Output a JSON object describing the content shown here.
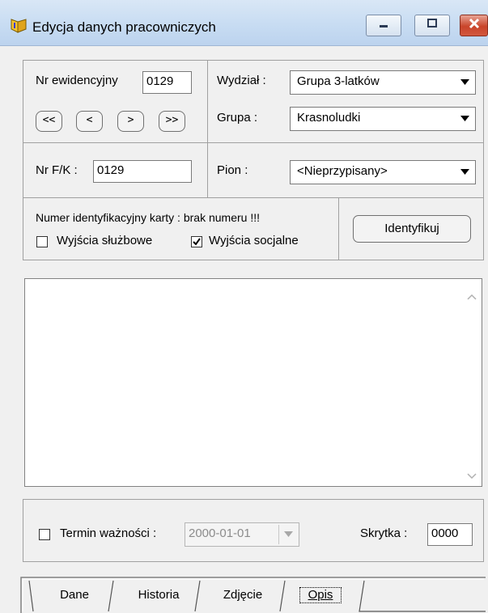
{
  "window": {
    "title": "Edycja danych pracowniczych",
    "icon": "app-shield-icon",
    "controls": [
      "minimize-icon",
      "maximize-icon",
      "close-icon"
    ]
  },
  "record": {
    "nr_ewidencyjny_label": "Nr ewidencyjny",
    "nr_ewidencyjny_value": "0129",
    "nav": [
      "<<",
      "<",
      ">",
      ">>"
    ],
    "nr_fk_label": "Nr F/K :",
    "nr_fk_value": "0129"
  },
  "org": {
    "wydzial_label": "Wydział :",
    "wydzial_value": "Grupa 3-latków",
    "grupa_label": "Grupa :",
    "grupa_value": "Krasnoludki",
    "pion_label": "Pion :",
    "pion_value": "<Nieprzypisany>"
  },
  "card": {
    "id_text": "Numer identyfikacyjny karty :  brak numeru !!!",
    "wyjscia_sluzbowe_label": "Wyjścia służbowe",
    "wyjscia_sluzbowe_checked": false,
    "wyjscia_socjalne_label": "Wyjścia socjalne",
    "wyjscia_socjalne_checked": true,
    "identify_button": "Identyfikuj"
  },
  "memo": {
    "text": ""
  },
  "validity": {
    "termin_label": "Termin ważności :",
    "termin_checked": false,
    "termin_value": "2000-01-01",
    "skrytka_label": "Skrytka :",
    "skrytka_value": "0000"
  },
  "tabs": [
    {
      "label": "Dane",
      "active": false
    },
    {
      "label": "Historia",
      "active": false
    },
    {
      "label": "Zdjęcie",
      "active": false
    },
    {
      "label": "Opis",
      "active": true
    }
  ]
}
